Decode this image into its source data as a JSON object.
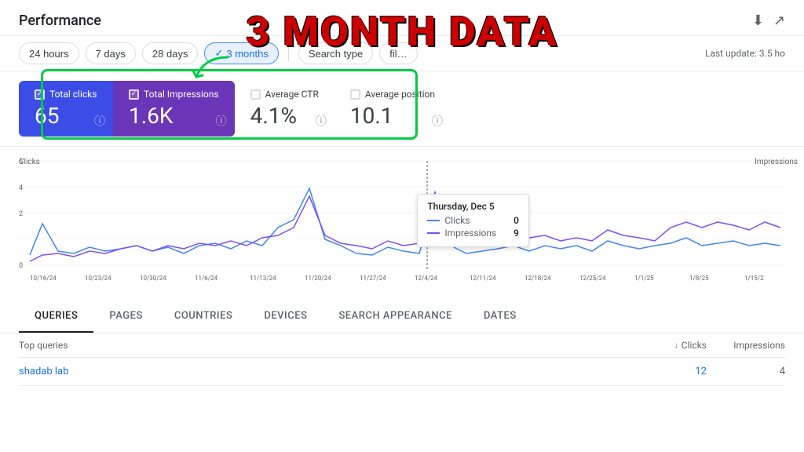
{
  "header": {
    "title": "Performance",
    "download_icon": "⬇",
    "external_icon": "↗"
  },
  "filters": {
    "buttons": [
      {
        "label": "24 hours",
        "active": false
      },
      {
        "label": "7 days",
        "active": false
      },
      {
        "label": "28 days",
        "active": false
      },
      {
        "label": "3 months",
        "active": true
      },
      {
        "label": "Search type",
        "active": false
      },
      {
        "label": "fil…",
        "active": false
      }
    ],
    "last_update": "Last update: 3.5 ho"
  },
  "metrics": {
    "total_clicks": {
      "label": "Total clicks",
      "value": "65"
    },
    "total_impressions": {
      "label": "Total Impressions",
      "value": "1.6K"
    },
    "avg_ctr": {
      "label": "Average CTR",
      "value": "4.1%"
    },
    "avg_position": {
      "label": "Average position",
      "value": "10.1"
    }
  },
  "chart": {
    "y_label_left": "Clicks",
    "y_label_right": "Impressions",
    "y_max_left": 6,
    "x_labels": [
      "10/16/24",
      "10/23/24",
      "10/30/24",
      "11/6/24",
      "11/13/24",
      "11/20/24",
      "11/27/24",
      "12/4/24",
      "12/11/24",
      "12/18/24",
      "12/25/24",
      "1/1/25",
      "1/8/25",
      "1/15/2"
    ]
  },
  "tooltip": {
    "date": "Thursday, Dec 5",
    "clicks_label": "Clicks",
    "clicks_value": "0",
    "impressions_label": "Impressions",
    "impressions_value": "9"
  },
  "tabs": [
    {
      "label": "QUERIES",
      "active": true
    },
    {
      "label": "PAGES",
      "active": false
    },
    {
      "label": "COUNTRIES",
      "active": false
    },
    {
      "label": "DEVICES",
      "active": false
    },
    {
      "label": "SEARCH APPEARANCE",
      "active": false
    },
    {
      "label": "DATES",
      "active": false
    }
  ],
  "table": {
    "col_query": "Top queries",
    "col_clicks": "Clicks",
    "col_impressions": "Impressions",
    "rows": [
      {
        "query": "shadab lab",
        "clicks": "12",
        "impressions": "4"
      }
    ]
  },
  "annotation": {
    "text": "3 MONTH DATA"
  }
}
